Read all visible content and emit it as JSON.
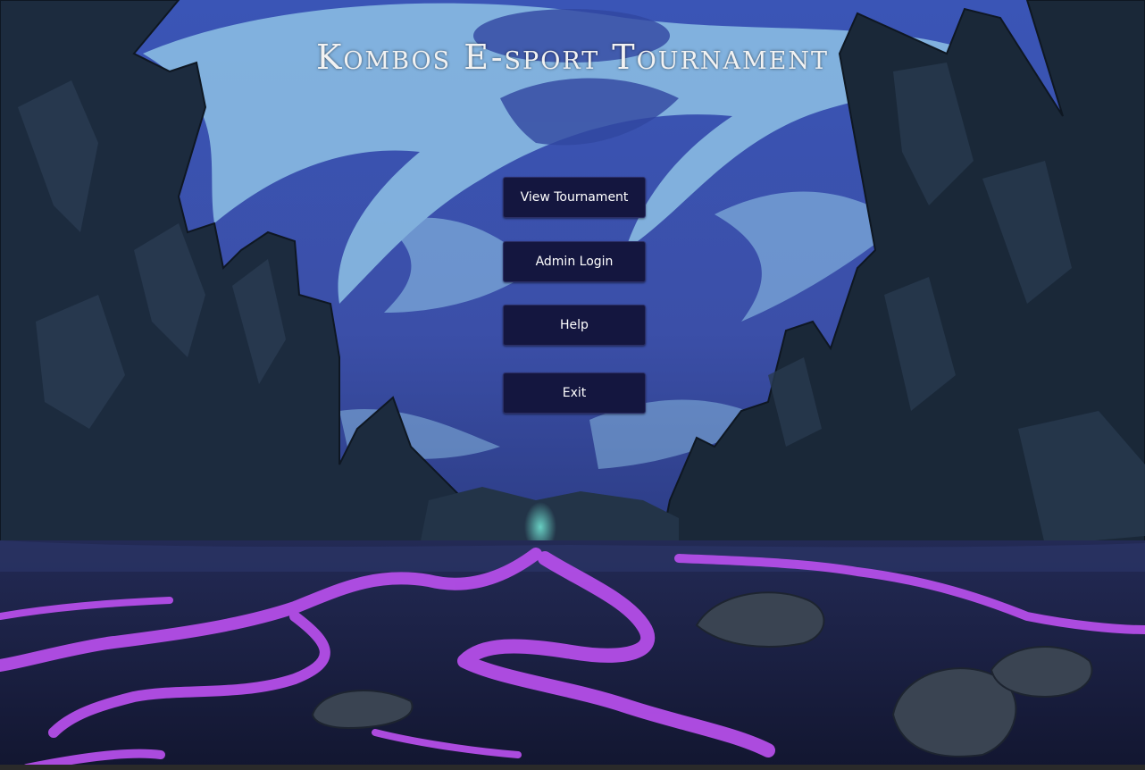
{
  "app": {
    "title": "Kombos E-sport Tournament"
  },
  "menu": {
    "view_tournament_label": "View Tournament",
    "admin_login_label": "Admin Login",
    "help_label": "Help",
    "exit_label": "Exit"
  },
  "colors": {
    "button_bg": "#14163f",
    "sky": "#3f57b8",
    "cloud": "#8fc3e6",
    "rock": "#1b2a3d",
    "lava": "#b04be0",
    "ground": "#151a33"
  }
}
